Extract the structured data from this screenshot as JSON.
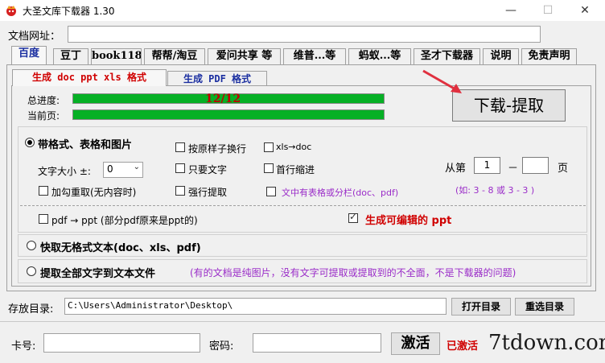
{
  "window": {
    "title": "大圣文库下载器 1.30",
    "minimize": "—",
    "maximize": "☐",
    "close": "✕"
  },
  "url_row": {
    "label": "文档网址：",
    "value": ""
  },
  "tabs": [
    "百度",
    "豆丁",
    "book118",
    "帮帮/淘豆",
    "爱问共享 等",
    "维普...等",
    "蚂蚁...等",
    "圣才下载器",
    "说明",
    "免责声明"
  ],
  "subtabs": {
    "active": "生成 doc ppt xls 格式",
    "inactive": "生成 PDF 格式"
  },
  "progress": {
    "total_label": "总进度:",
    "current_label": "当前页:",
    "text": "12/12",
    "total_fraction": 1.0,
    "current_fraction": 1.0,
    "bar_color": "#06b025"
  },
  "download_button": "下载-提取",
  "options": {
    "format_radio": "带格式、表格和图片",
    "font_size_label": "文字大小 ±:",
    "font_size_value": "0",
    "reload_check": "加勾重取(无内容时)",
    "line_break_check": "按原样子换行",
    "text_only_check": "只要文字",
    "force_check": "强行提取",
    "xls_doc_check": "xls→doc",
    "indent_check": "首行缩进",
    "table_check": "文中有表格或分栏(doc、pdf)",
    "page_from": "从第",
    "page_start": "1",
    "page_dash": "－",
    "page_end": "",
    "page_unit": "页",
    "page_example": "(如: 3 - 8  或 3 - 3 )",
    "pdf_ppt_check": "pdf → ppt (部分pdf原来是ppt的)",
    "editable_ppt_check": "生成可编辑的 ppt",
    "quick_radio": "快取无格式文本(doc、xls、pdf)",
    "all_text_radio": "提取全部文字到文本文件",
    "note": "(有的文档是纯图片，没有文字可提取或提取到的不全面，不是下载器的问题)"
  },
  "save_dir": {
    "label": "存放目录:",
    "path": "C:\\Users\\Administrator\\Desktop\\",
    "open_btn": "打开目录",
    "reselect_btn": "重选目录"
  },
  "activation": {
    "card_label": "卡号:",
    "card_value": "",
    "password_label": "密码:",
    "password_value": "",
    "activate_btn": "激活",
    "status": "已激活"
  },
  "watermark": "7tdown.com",
  "colors": {
    "accent_red": "#d00000",
    "tab_blue": "#1a2ea0",
    "note_purple": "#9a2cc8",
    "progress_green": "#06b025"
  }
}
